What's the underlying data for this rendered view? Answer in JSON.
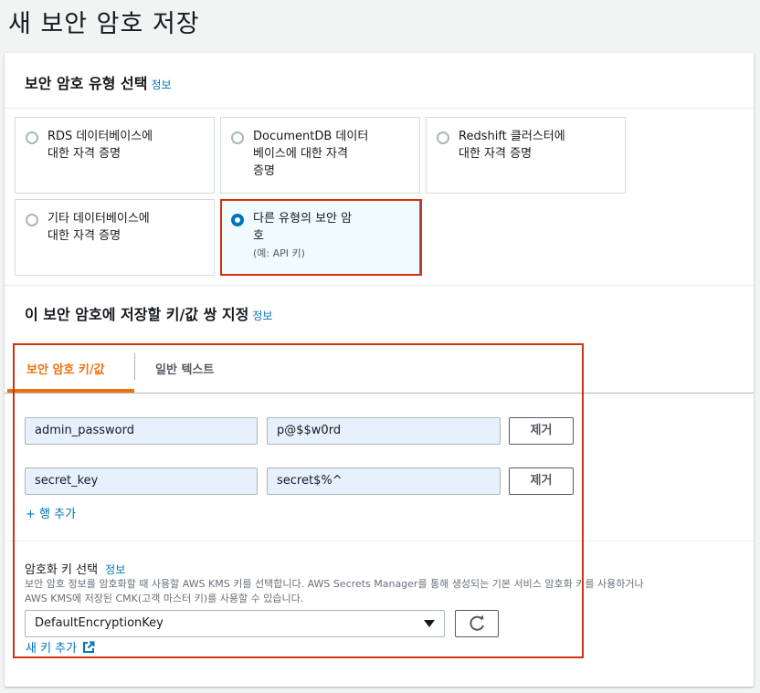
{
  "page": {
    "title": "새 보안 암호 저장"
  },
  "type_section": {
    "title": "보안 암호 유형 선택",
    "info": "정보",
    "options": [
      {
        "label_line1": "RDS 데이터베이스에",
        "label_line2": "대한 자격 증명",
        "label_line3": "",
        "desc": "",
        "selected": false
      },
      {
        "label_line1": "DocumentDB 데이터",
        "label_line2": "베이스에 대한 자격",
        "label_line3": "증명",
        "desc": "",
        "selected": false
      },
      {
        "label_line1": "Redshift 클러스터에",
        "label_line2": "대한 자격 증명",
        "label_line3": "",
        "desc": "",
        "selected": false
      },
      {
        "label_line1": "기타 데이터베이스에",
        "label_line2": "대한 자격 증명",
        "label_line3": "",
        "desc": "",
        "selected": false
      },
      {
        "label_line1": "다른 유형의 보안 암",
        "label_line2": "호",
        "label_line3": "",
        "desc": "(예: API 키)",
        "selected": true
      }
    ]
  },
  "kv_section": {
    "title": "이 보안 암호에 저장할 키/값 쌍 지정",
    "info": "정보",
    "tabs": [
      {
        "label": "보안 암호 키/값",
        "active": true
      },
      {
        "label": "일반 텍스트",
        "active": false
      }
    ],
    "rows": [
      {
        "key": "admin_password",
        "value": "p@$$w0rd",
        "remove_label": "제거"
      },
      {
        "key": "secret_key",
        "value": "secret$%^",
        "remove_label": "제거"
      }
    ],
    "add_row": "+ 행 추가"
  },
  "encryption": {
    "label": "암호화 키 선택",
    "info": "정보",
    "desc_line1": "보안 암호 정보를 암호화할 때 사용할 AWS KMS 키를 선택합니다. AWS Secrets Manager를 통해 생성되는 기본 서비스 암호화 키를 사용하거나",
    "desc_line2": "AWS KMS에 저장된 CMK(고객 마스터 키)를 사용할 수 있습니다.",
    "selected_key": "DefaultEncryptionKey",
    "add_key": "새 키 추가"
  },
  "colors": {
    "accent": "#ec7211",
    "link": "#0073bb",
    "highlight": "#d13212",
    "selected_bg": "#f1faff"
  },
  "icons": {
    "refresh": "refresh-icon",
    "external": "external-link-icon",
    "caret": "caret-down-icon"
  }
}
